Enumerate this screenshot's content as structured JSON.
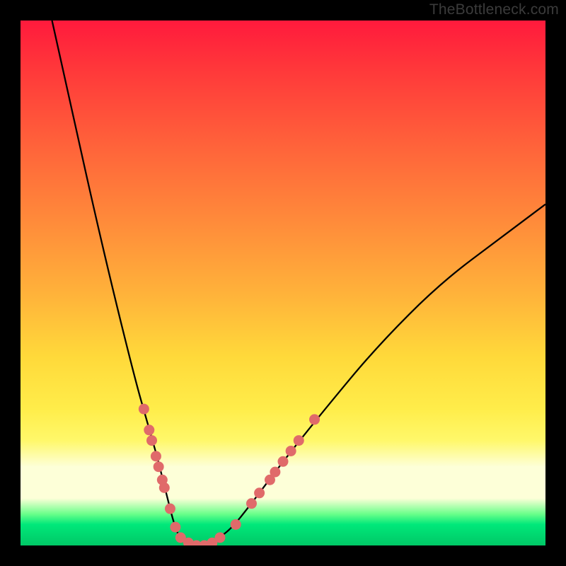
{
  "attribution": "TheBottleneck.com",
  "colors": {
    "frame": "#000000",
    "curve": "#000000",
    "dot": "#e06a6a",
    "gradient_stops": [
      "#ff1a3c",
      "#ff663a",
      "#ffb23a",
      "#ffed4a",
      "#fdffd8",
      "#00d870"
    ]
  },
  "chart_data": {
    "type": "line",
    "title": "",
    "xlabel": "",
    "ylabel": "",
    "xlim": [
      0,
      100
    ],
    "ylim": [
      0,
      100
    ],
    "annotations": [
      "TheBottleneck.com"
    ],
    "series": [
      {
        "name": "bottleneck-curve",
        "x": [
          6,
          10,
          14,
          18,
          22,
          24,
          26,
          27,
          28,
          29,
          30,
          31,
          33,
          35,
          37,
          40,
          44,
          50,
          58,
          68,
          80,
          92,
          100
        ],
        "y": [
          100,
          82,
          64,
          47,
          31,
          24,
          17,
          13,
          9,
          5,
          2,
          1,
          0,
          0,
          1,
          3,
          8,
          16,
          26,
          38,
          50,
          59,
          65
        ]
      }
    ],
    "highlight_dots": {
      "name": "marked-points",
      "description": "pink dots along the bottom of the V",
      "points": [
        {
          "x": 23.5,
          "y": 26
        },
        {
          "x": 24.5,
          "y": 22
        },
        {
          "x": 25.0,
          "y": 20
        },
        {
          "x": 25.8,
          "y": 17
        },
        {
          "x": 26.3,
          "y": 15
        },
        {
          "x": 27.0,
          "y": 12.5
        },
        {
          "x": 27.4,
          "y": 11
        },
        {
          "x": 28.5,
          "y": 7
        },
        {
          "x": 29.5,
          "y": 3.5
        },
        {
          "x": 30.5,
          "y": 1.5
        },
        {
          "x": 32.0,
          "y": 0.5
        },
        {
          "x": 33.5,
          "y": 0
        },
        {
          "x": 35.0,
          "y": 0
        },
        {
          "x": 36.5,
          "y": 0.5
        },
        {
          "x": 38.0,
          "y": 1.5
        },
        {
          "x": 41.0,
          "y": 4
        },
        {
          "x": 44.0,
          "y": 8
        },
        {
          "x": 45.5,
          "y": 10
        },
        {
          "x": 47.5,
          "y": 12.5
        },
        {
          "x": 48.5,
          "y": 14
        },
        {
          "x": 50.0,
          "y": 16
        },
        {
          "x": 51.5,
          "y": 18
        },
        {
          "x": 53.0,
          "y": 20
        },
        {
          "x": 56.0,
          "y": 24
        }
      ]
    }
  }
}
